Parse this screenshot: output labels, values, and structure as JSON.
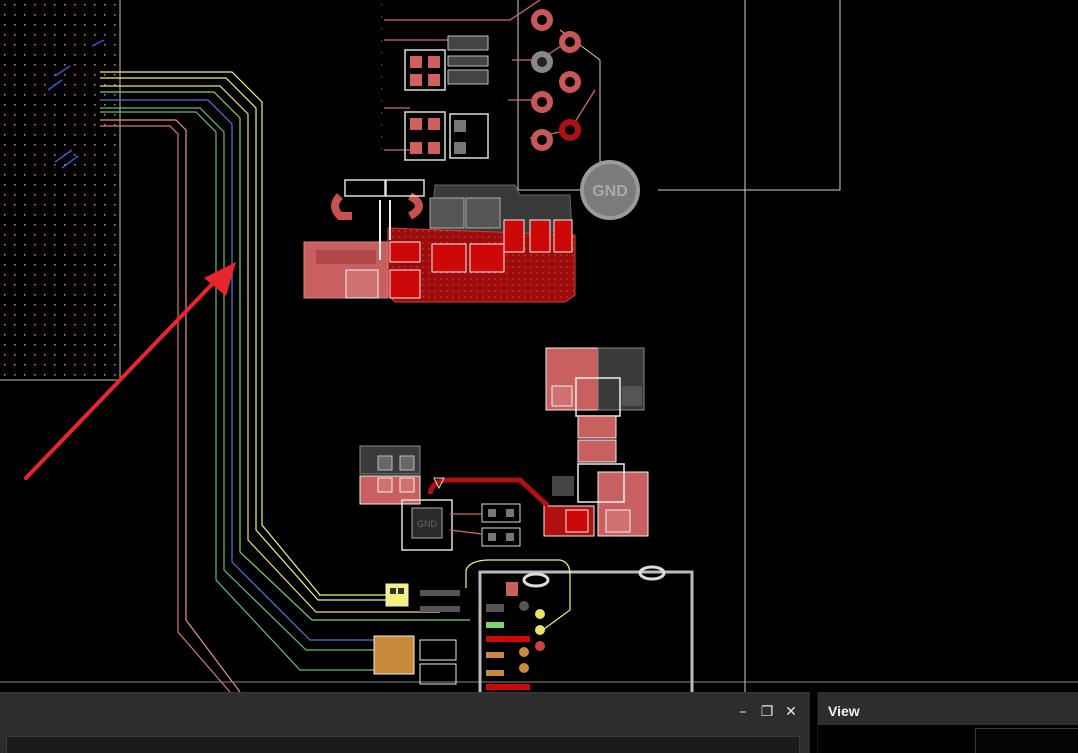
{
  "pcb": {
    "gnd_pad_label": "GND",
    "ic_label": "GND",
    "background_color": "#000000",
    "copper_color": "#b01010",
    "trace_colors": [
      "#f4f27a",
      "#e9e36a",
      "#7fd36a",
      "#4a78d8",
      "#5bbf7a",
      "#e39a7a",
      "#d67a6a"
    ],
    "annotation_arrow_color": "#e8262d"
  },
  "bottom_panel": {
    "minimize_icon": "minimize-icon",
    "restore_icon": "restore-icon",
    "close_icon": "close-icon",
    "minimize_glyph": "–",
    "restore_glyph": "❐",
    "close_glyph": "✕"
  },
  "view_panel": {
    "title": "View"
  }
}
